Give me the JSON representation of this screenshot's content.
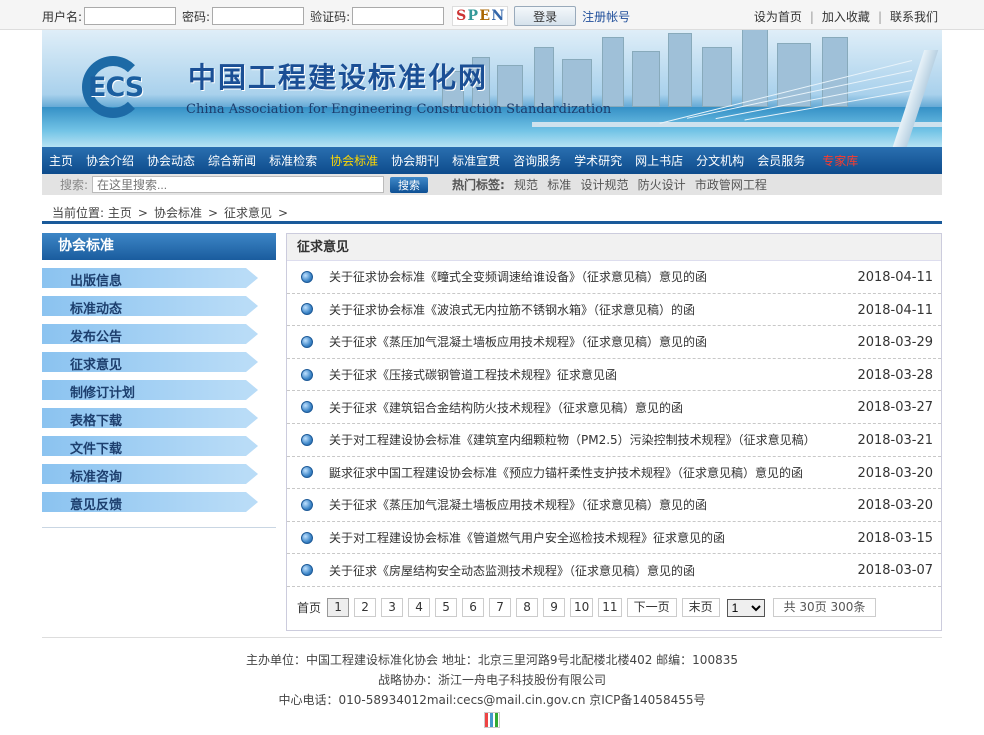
{
  "login": {
    "username_label": "用户名:",
    "password_label": "密码:",
    "captcha_label": "验证码:",
    "captcha_chars": [
      "S",
      "P",
      "E",
      "N"
    ],
    "login_button": "登录",
    "register_link": "注册帐号"
  },
  "top_links": [
    "设为首页",
    "加入收藏",
    "联系我们"
  ],
  "banner": {
    "logo_text": "ECS",
    "title_cn": "中国工程建设标准化网",
    "title_en": "China Association for Engineering Construction Standardization"
  },
  "nav": {
    "items": [
      "主页",
      "协会介绍",
      "协会动态",
      "综合新闻",
      "标准检索",
      "协会标准",
      "协会期刊",
      "标准宣贯",
      "咨询服务",
      "学术研究",
      "网上书店",
      "分文机构",
      "会员服务",
      "专家库"
    ],
    "active": "协会标准",
    "highlight": "专家库"
  },
  "search": {
    "label": "搜索:",
    "placeholder": "在这里搜索...",
    "button": "搜索",
    "hot_label": "热门标签:",
    "hot_tags": [
      "规范",
      "标准",
      "设计规范",
      "防火设计",
      "市政管网工程"
    ]
  },
  "breadcrumb": {
    "prefix": "当前位置:",
    "items": [
      "主页",
      "协会标准",
      "征求意见"
    ]
  },
  "sidebar": {
    "title": "协会标准",
    "items": [
      "出版信息",
      "标准动态",
      "发布公告",
      "征求意见",
      "制修订计划",
      "表格下载",
      "文件下载",
      "标准咨询",
      "意见反馈"
    ]
  },
  "content": {
    "title": "征求意见",
    "rows": [
      {
        "title": "关于征求协会标准《疃式全变频调速给谁设备》（征求意见稿）意见的函",
        "date": "2018-04-11"
      },
      {
        "title": "关于征求协会标准《波浪式无内拉筋不锈钢水箱》（征求意见稿）的函",
        "date": "2018-04-11"
      },
      {
        "title": "关于征求《蒸压加气混凝土墙板应用技术规程》（征求意见稿）意见的函",
        "date": "2018-03-29"
      },
      {
        "title": "关于征求《压接式碳钢管道工程技术规程》征求意见函",
        "date": "2018-03-28"
      },
      {
        "title": "关于征求《建筑铝合金结构防火技术规程》（征求意见稿）意见的函",
        "date": "2018-03-27"
      },
      {
        "title": "关于对工程建设协会标准《建筑室内细颗粒物（PM2.5）污染控制技术规程》（征求意见稿）",
        "date": "2018-03-21"
      },
      {
        "title": "鼮求征求中国工程建设协会标准《预应力锚杆柔性支护技术规程》（征求意见稿）意见的函",
        "date": "2018-03-20"
      },
      {
        "title": "关于征求《蒸压加气混凝土墙板应用技术规程》（征求意见稿）意见的函",
        "date": "2018-03-20"
      },
      {
        "title": "关于对工程建设协会标准《管道燃气用户安全巡检技术规程》征求意见的函",
        "date": "2018-03-15"
      },
      {
        "title": "关于征求《房屋结构安全动态监测技术规程》（征求意见稿）意见的函",
        "date": "2018-03-07"
      }
    ]
  },
  "pager": {
    "first": "首页",
    "pages": [
      "1",
      "2",
      "3",
      "4",
      "5",
      "6",
      "7",
      "8",
      "9",
      "10",
      "11"
    ],
    "current": "1",
    "next": "下一页",
    "last": "末页",
    "select_value": "1",
    "total": "共 30页 300条"
  },
  "footer": {
    "line1": "主办单位：中国工程建设标准化协会 地址：北京三里河路9号北配楼北楼402 邮编：100835",
    "line2": "战略协办：浙江一舟电子科技股份有限公司",
    "line3": "中心电话：010-58934012mail:cecs@mail.cin.gov.cn 京ICP备14058455号"
  },
  "colors": {
    "nav_bg": "#1a5c9e",
    "nav_active": "#ffd700",
    "nav_highlight": "#ff3b2b",
    "sidebar_item": "#8bc3f0"
  },
  "icons": [
    "list-bullet-icon",
    "site-stat-icon"
  ]
}
